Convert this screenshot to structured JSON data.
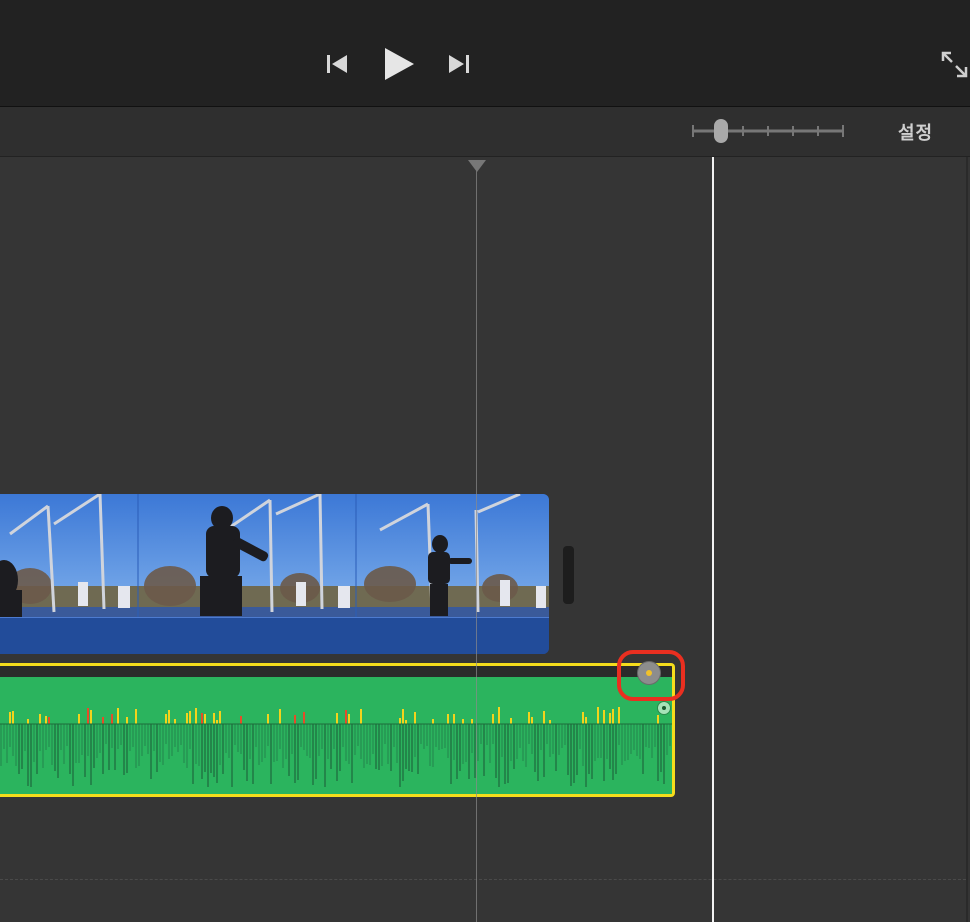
{
  "toolbar": {
    "settings_label": "설정"
  },
  "controls": {
    "skip_back_icon": "skip-to-start-icon",
    "play_icon": "play-icon",
    "skip_forward_icon": "skip-to-end-icon",
    "fullscreen_icon": "fullscreen-expand-icon"
  },
  "colors": {
    "background": "#353535",
    "top_bar": "#222222",
    "video_track": "#224c9a",
    "audio_fill": "#2bb45e",
    "audio_selection_border": "#f5dc1c",
    "annotation": "#ea2f20",
    "playhead": "#f2f2f2"
  }
}
